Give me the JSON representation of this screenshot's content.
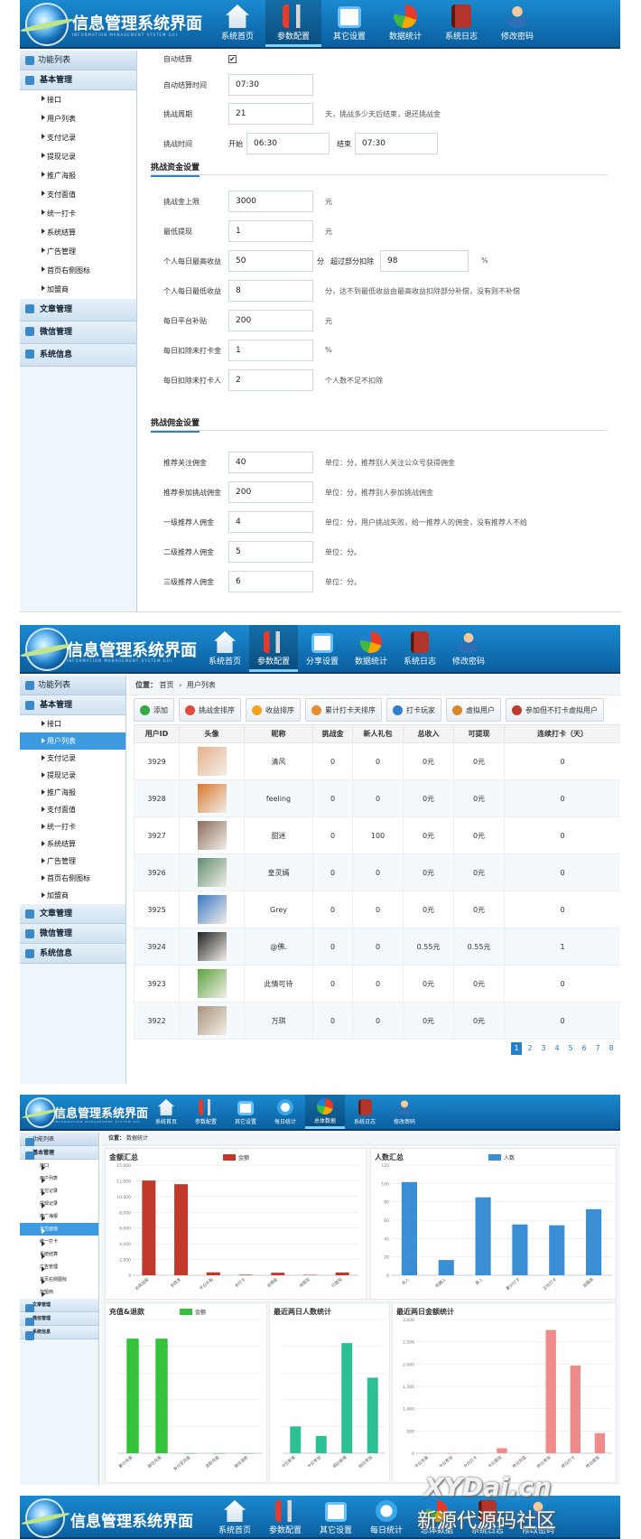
{
  "app": {
    "title": "信息管理系统界面",
    "subtitle": "INFORMATION MANAGEMENT SYSTEM GUI"
  },
  "panel1": {
    "nav": [
      {
        "label": "系统首页",
        "icon": "home-icon"
      },
      {
        "label": "参数配置",
        "icon": "tools-icon"
      },
      {
        "label": "其它设置",
        "icon": "exit-icon"
      },
      {
        "label": "数据统计",
        "icon": "pie-chart-icon"
      },
      {
        "label": "系统日志",
        "icon": "book-icon"
      },
      {
        "label": "修改密码",
        "icon": "user-icon"
      }
    ],
    "sidebar": {
      "head": "功能列表",
      "section1": "基本管理",
      "items": [
        "接口",
        "用户列表",
        "支付记录",
        "提现记录",
        "推广海报",
        "支付面值",
        "统一打卡",
        "系统结算",
        "广告管理",
        "首页右侧图标",
        "加盟商"
      ],
      "sections": [
        "文章管理",
        "微信管理",
        "系统信息"
      ]
    },
    "form": {
      "auto_settle": "自动结算",
      "auto_time_label": "自动结算时间",
      "auto_time_value": "07:30",
      "cycle_label": "挑战周期",
      "cycle_value": "21",
      "cycle_hint": "天，挑战多少天后结束，退还挑战金",
      "time_label": "挑战时间",
      "start_label": "开始",
      "start_value": "06:30",
      "end_label": "结束",
      "end_value": "07:30",
      "sec_fund": "挑战资金设置",
      "limit_label": "挑战金上限",
      "limit_value": "3000",
      "limit_unit": "元",
      "minw_label": "最低提现",
      "minw_value": "1",
      "minw_unit": "元",
      "maxd_label": "个人每日最高收益",
      "maxd_value": "50",
      "maxd_unit": "分",
      "maxd_over_label": "超过部分扣除",
      "maxd_over_value": "98",
      "maxd_over_unit": "%",
      "mind_label": "个人每日最低收益",
      "mind_value": "8",
      "mind_hint": "分，达不到最低收益由最高收益扣除部分补偿，没有则不补偿",
      "sub_label": "每日平台补贴",
      "sub_value": "200",
      "sub_unit": "元",
      "ded_label": "每日扣除未打卡金",
      "ded_value": "1",
      "ded_unit": "%",
      "dedp_label": "每日扣除未打卡人",
      "dedp_value": "2",
      "dedp_hint": "个人数不足不扣除",
      "sec_comm": "挑战佣金设置",
      "c1_label": "推荐关注佣金",
      "c1_value": "40",
      "c1_hint": "单位：分，推荐别人关注公众号获得佣金",
      "c2_label": "推荐参加挑战佣金",
      "c2_value": "200",
      "c2_hint": "单位：分，推荐别人参加挑战佣金",
      "c3_label": "一级推荐人佣金",
      "c3_value": "4",
      "c3_hint": "单位：分，用户挑战失败，给一推荐人的佣金，没有推荐人不给",
      "c4_label": "二级推荐人佣金",
      "c4_value": "5",
      "c4_hint": "单位：分。",
      "c5_label": "三级推荐人佣金",
      "c5_value": "6",
      "c5_hint": "单位：分。"
    }
  },
  "panel2": {
    "nav": [
      {
        "label": "系统首页",
        "icon": "home-icon"
      },
      {
        "label": "参数配置",
        "icon": "tools-icon"
      },
      {
        "label": "分享设置",
        "icon": "exit-icon"
      },
      {
        "label": "数据统计",
        "icon": "pie-chart-icon"
      },
      {
        "label": "系统日志",
        "icon": "book-icon"
      },
      {
        "label": "修改密码",
        "icon": "user-icon"
      }
    ],
    "breadcrumb": {
      "label": "位置：",
      "home": "首页",
      "sep": "›",
      "current": "用户列表"
    },
    "toolbar": [
      "添加",
      "挑战金排序",
      "收益排序",
      "累计打卡天排序",
      "打卡玩家",
      "虚拟用户",
      "参加但不打卡虚拟用户"
    ],
    "toolbar_colors": [
      "#35a845",
      "#e24a3b",
      "#f4a21b",
      "#e88c2a",
      "#2f7fcb",
      "#d9892a",
      "#c0392b"
    ],
    "columns": [
      "用户ID",
      "头像",
      "昵称",
      "挑战金",
      "新人礼包",
      "总收入",
      "可提现",
      "连续打卡（天）"
    ],
    "rows": [
      {
        "id": "3929",
        "name": "清风",
        "fund": "0",
        "gift": "0",
        "income": "0元",
        "withdraw": "0元",
        "days": "0",
        "avatar": "#e9b08a"
      },
      {
        "id": "3928",
        "name": "feeling",
        "fund": "0",
        "gift": "0",
        "income": "0元",
        "withdraw": "0元",
        "days": "0",
        "avatar": "#d9772e"
      },
      {
        "id": "3927",
        "name": "甜迷",
        "fund": "0",
        "gift": "100",
        "income": "0元",
        "withdraw": "0元",
        "days": "0",
        "avatar": "#8c6b5a"
      },
      {
        "id": "3926",
        "name": "皇灵嫣",
        "fund": "0",
        "gift": "0",
        "income": "0元",
        "withdraw": "0元",
        "days": "0",
        "avatar": "#5f8d6f"
      },
      {
        "id": "3925",
        "name": "Grey",
        "fund": "0",
        "gift": "0",
        "income": "0元",
        "withdraw": "0元",
        "days": "0",
        "avatar": "#3a78c4"
      },
      {
        "id": "3924",
        "name": "@佛.",
        "fund": "0",
        "gift": "0",
        "income": "0.55元",
        "withdraw": "0.55元",
        "days": "1",
        "avatar": "#222222"
      },
      {
        "id": "3923",
        "name": "此情可待",
        "fund": "0",
        "gift": "0",
        "income": "0元",
        "withdraw": "0元",
        "days": "0",
        "avatar": "#5aa33b"
      },
      {
        "id": "3922",
        "name": "万琪",
        "fund": "0",
        "gift": "0",
        "income": "0元",
        "withdraw": "0元",
        "days": "0",
        "avatar": "#a8927a"
      }
    ],
    "pages": [
      "1",
      "2",
      "3",
      "4",
      "5",
      "6",
      "7",
      "8"
    ]
  },
  "panel3": {
    "nav": [
      {
        "label": "系统首页",
        "icon": "home-icon"
      },
      {
        "label": "参数配置",
        "icon": "tools-icon"
      },
      {
        "label": "其它设置",
        "icon": "exit-icon"
      },
      {
        "label": "每日统计",
        "icon": "money-icon"
      },
      {
        "label": "总体数据",
        "icon": "pie-chart-icon"
      },
      {
        "label": "系统日志",
        "icon": "book-icon"
      },
      {
        "label": "修改密码",
        "icon": "user-icon"
      }
    ],
    "breadcrumb": {
      "label": "位置：",
      "current": "数据统计"
    }
  },
  "panel4": {
    "nav": [
      {
        "label": "系统首页",
        "icon": "home-icon"
      },
      {
        "label": "参数配置",
        "icon": "tools-icon"
      },
      {
        "label": "其它设置",
        "icon": "exit-icon"
      },
      {
        "label": "每日统计",
        "icon": "money-icon"
      },
      {
        "label": "总体数据",
        "icon": "pie-chart-icon"
      },
      {
        "label": "系统日志",
        "icon": "book-icon"
      },
      {
        "label": "修改密码",
        "icon": "user-icon"
      }
    ]
  },
  "watermark": {
    "line1": "XYDai.cn",
    "line2": "新源代源码社区"
  },
  "chart_data": [
    {
      "type": "bar",
      "title": "金额汇总",
      "legend": "金额",
      "color": "#c0392b",
      "categories": [
        "总挑战金",
        "总收支",
        "平台补贴",
        "未打卡",
        "总佣金",
        "待提现",
        "已提现"
      ],
      "values": [
        12900,
        12400,
        400,
        80,
        350,
        60,
        380
      ],
      "ylim": [
        0,
        15000
      ],
      "yticks": [
        "0",
        "2,000",
        "4,000",
        "6,000",
        "8,000",
        "10,000",
        "12,000",
        "15,000"
      ]
    },
    {
      "type": "bar",
      "title": "人数汇总",
      "legend": "人数",
      "color": "#3a8fd4",
      "categories": [
        "总人",
        "机器人",
        "真人",
        "累计打卡",
        "正在打卡",
        "加盟商"
      ],
      "values": [
        110,
        18,
        92,
        60,
        59,
        78
      ],
      "ylim": [
        0,
        130
      ],
      "yticks": [
        "0",
        "20",
        "40",
        "60",
        "80",
        "100",
        "120"
      ]
    },
    {
      "type": "bar",
      "title": "充值&退款",
      "legend": "金额",
      "color": "#34c23c",
      "categories": [
        "累计充值",
        "微信充值",
        "支付宝充值",
        "退款充值",
        "微信退款"
      ],
      "values": [
        600,
        600,
        0,
        0,
        0
      ],
      "ylim": [
        0,
        700
      ],
      "yticks": []
    },
    {
      "type": "bar",
      "title": "最近两日人数统计",
      "legend": "",
      "color": "#2dbf94",
      "categories": [
        "今日新增",
        "今日参加",
        "明日新增",
        "明日参加"
      ],
      "values": [
        17,
        11,
        70,
        48
      ],
      "ylim": [
        0,
        85
      ],
      "yticks": []
    },
    {
      "type": "bar",
      "title": "最近两日金额统计",
      "legend": "",
      "color": "#ef8b8b",
      "categories": [
        "今日充值",
        "今日参加",
        "今日打卡",
        "今日提现",
        "昨日充值",
        "昨日参加",
        "昨日打卡",
        "昨日提现"
      ],
      "values": [
        0,
        0,
        0,
        120,
        0,
        2950,
        2100,
        480
      ],
      "ylim": [
        0,
        3200
      ],
      "yticks": [
        "0",
        "500",
        "1,000",
        "1,500",
        "2,000",
        "2,500",
        "3,000"
      ]
    }
  ]
}
